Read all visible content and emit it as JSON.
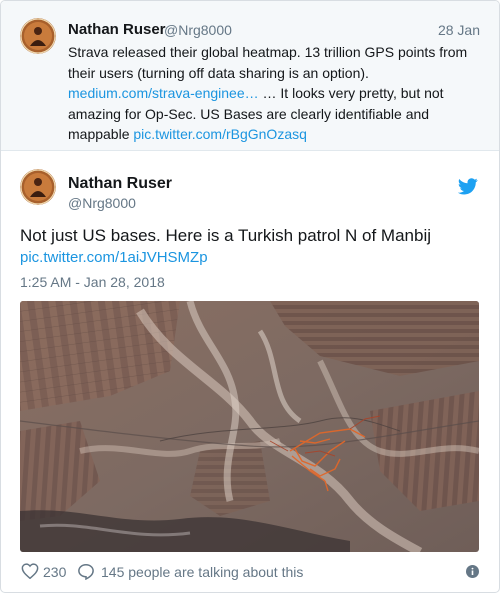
{
  "parent_tweet": {
    "author_name": "Nathan Ruser",
    "author_handle": "@Nrg8000",
    "date": "28 Jan",
    "text_1": "Strava released their global heatmap. 13 trillion GPS points from their users (turning off data sharing is an option).",
    "link_1": "medium.com/strava-enginee…",
    "text_2": " … It looks very pretty, but not amazing for Op-Sec. US Bases are clearly identifiable and mappable ",
    "link_2": "pic.twitter.com/rBgGnOzasq"
  },
  "main_tweet": {
    "author_name": "Nathan Ruser",
    "author_handle": "@Nrg8000",
    "text": "Not just US bases. Here is a Turkish patrol N of Manbij",
    "link": "pic.twitter.com/1aiJVHSMZp",
    "timestamp": "1:25 AM - Jan 28, 2018",
    "likes": "230",
    "talking": "145 people are talking about this"
  },
  "colors": {
    "link": "#1b95e0",
    "muted": "#657786",
    "twitter_blue": "#1da1f2",
    "heat_track": "#e0672a"
  },
  "icons": {
    "brand": "twitter-bird-icon",
    "like": "heart-icon",
    "reply": "reply-bubble-icon",
    "info": "info-icon"
  }
}
